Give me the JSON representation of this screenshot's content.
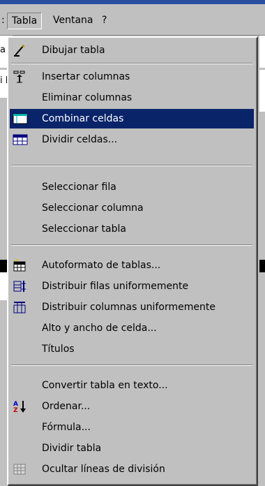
{
  "menubar": {
    "left_fragment": ":",
    "items": [
      "Tabla",
      "Ventana",
      "?"
    ]
  },
  "background": {
    "edge_fragments": [
      "a",
      "i F"
    ]
  },
  "menu": {
    "items": [
      {
        "label": "Dibujar tabla",
        "icon": "pencil-icon"
      },
      {
        "label": "Insertar columnas",
        "icon": "insert-columns-icon"
      },
      {
        "label": "Eliminar columnas",
        "icon": null
      },
      {
        "label": "Combinar celdas",
        "icon": "merge-cells-icon",
        "highlighted": true
      },
      {
        "label": "Dividir celdas...",
        "icon": "split-cells-icon"
      },
      {
        "label": "Seleccionar fila",
        "icon": null
      },
      {
        "label": "Seleccionar columna",
        "icon": null
      },
      {
        "label": "Seleccionar tabla",
        "icon": null
      },
      {
        "label": "Autoformato de tablas...",
        "icon": "table-autoformat-icon"
      },
      {
        "label": "Distribuir filas uniformemente",
        "icon": "distribute-rows-icon"
      },
      {
        "label": "Distribuir columnas uniformemente",
        "icon": "distribute-columns-icon"
      },
      {
        "label": "Alto y ancho de celda...",
        "icon": null
      },
      {
        "label": "Títulos",
        "icon": null
      },
      {
        "label": "Convertir tabla en texto...",
        "icon": null
      },
      {
        "label": "Ordenar...",
        "icon": "sort-az-icon"
      },
      {
        "label": "Fórmula...",
        "icon": null
      },
      {
        "label": "Dividir tabla",
        "icon": null
      },
      {
        "label": "Ocultar líneas de división",
        "icon": "gridlines-icon"
      }
    ]
  },
  "colors": {
    "highlight": "#0a246a",
    "menu_bg": "#c0c0c0"
  }
}
